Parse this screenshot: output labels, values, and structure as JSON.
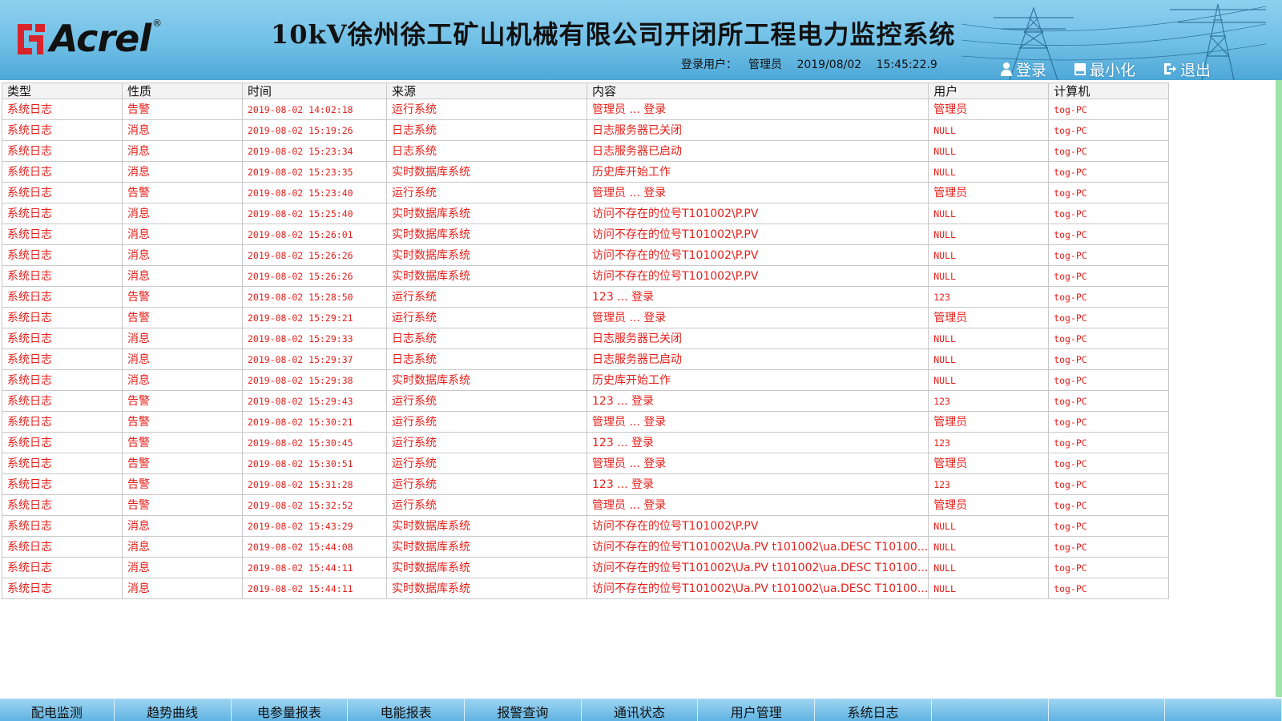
{
  "header": {
    "logo_text": "Acrel",
    "logo_reg": "®",
    "title": "10kV徐州徐工矿山机械有限公司开闭所工程电力监控系统",
    "login_label": "登录用户：",
    "login_user": "管理员",
    "date": "2019/08/02",
    "time": "15:45:22.9",
    "buttons": [
      {
        "label": "登录",
        "icon": "user-icon"
      },
      {
        "label": "最小化",
        "icon": "minimize-icon"
      },
      {
        "label": "退出",
        "icon": "exit-icon"
      }
    ]
  },
  "table": {
    "columns": [
      "类型",
      "性质",
      "时间",
      "来源",
      "内容",
      "用户",
      "计算机"
    ],
    "rows": [
      [
        "系统日志",
        "告警",
        "2019-08-02 14:02:18",
        "运行系统",
        "管理员 ... 登录",
        "管理员",
        "tog-PC"
      ],
      [
        "系统日志",
        "消息",
        "2019-08-02 15:19:26",
        "日志系统",
        "日志服务器已关闭",
        "NULL",
        "tog-PC"
      ],
      [
        "系统日志",
        "消息",
        "2019-08-02 15:23:34",
        "日志系统",
        "日志服务器已启动",
        "NULL",
        "tog-PC"
      ],
      [
        "系统日志",
        "消息",
        "2019-08-02 15:23:35",
        "实时数据库系统",
        "历史库开始工作",
        "NULL",
        "tog-PC"
      ],
      [
        "系统日志",
        "告警",
        "2019-08-02 15:23:40",
        "运行系统",
        "管理员 ... 登录",
        "管理员",
        "tog-PC"
      ],
      [
        "系统日志",
        "消息",
        "2019-08-02 15:25:40",
        "实时数据库系统",
        "访问不存在的位号T101002\\P.PV",
        "NULL",
        "tog-PC"
      ],
      [
        "系统日志",
        "消息",
        "2019-08-02 15:26:01",
        "实时数据库系统",
        "访问不存在的位号T101002\\P.PV",
        "NULL",
        "tog-PC"
      ],
      [
        "系统日志",
        "消息",
        "2019-08-02 15:26:26",
        "实时数据库系统",
        "访问不存在的位号T101002\\P.PV",
        "NULL",
        "tog-PC"
      ],
      [
        "系统日志",
        "消息",
        "2019-08-02 15:26:26",
        "实时数据库系统",
        "访问不存在的位号T101002\\P.PV",
        "NULL",
        "tog-PC"
      ],
      [
        "系统日志",
        "告警",
        "2019-08-02 15:28:50",
        "运行系统",
        "123 ... 登录",
        "123",
        "tog-PC"
      ],
      [
        "系统日志",
        "告警",
        "2019-08-02 15:29:21",
        "运行系统",
        "管理员 ... 登录",
        "管理员",
        "tog-PC"
      ],
      [
        "系统日志",
        "消息",
        "2019-08-02 15:29:33",
        "日志系统",
        "日志服务器已关闭",
        "NULL",
        "tog-PC"
      ],
      [
        "系统日志",
        "消息",
        "2019-08-02 15:29:37",
        "日志系统",
        "日志服务器已启动",
        "NULL",
        "tog-PC"
      ],
      [
        "系统日志",
        "消息",
        "2019-08-02 15:29:38",
        "实时数据库系统",
        "历史库开始工作",
        "NULL",
        "tog-PC"
      ],
      [
        "系统日志",
        "告警",
        "2019-08-02 15:29:43",
        "运行系统",
        "123 ... 登录",
        "123",
        "tog-PC"
      ],
      [
        "系统日志",
        "告警",
        "2019-08-02 15:30:21",
        "运行系统",
        "管理员 ... 登录",
        "管理员",
        "tog-PC"
      ],
      [
        "系统日志",
        "告警",
        "2019-08-02 15:30:45",
        "运行系统",
        "123 ... 登录",
        "123",
        "tog-PC"
      ],
      [
        "系统日志",
        "告警",
        "2019-08-02 15:30:51",
        "运行系统",
        "管理员 ... 登录",
        "管理员",
        "tog-PC"
      ],
      [
        "系统日志",
        "告警",
        "2019-08-02 15:31:28",
        "运行系统",
        "123 ... 登录",
        "123",
        "tog-PC"
      ],
      [
        "系统日志",
        "告警",
        "2019-08-02 15:32:52",
        "运行系统",
        "管理员 ... 登录",
        "管理员",
        "tog-PC"
      ],
      [
        "系统日志",
        "消息",
        "2019-08-02 15:43:29",
        "实时数据库系统",
        "访问不存在的位号T101002\\P.PV",
        "NULL",
        "tog-PC"
      ],
      [
        "系统日志",
        "消息",
        "2019-08-02 15:44:08",
        "实时数据库系统",
        "访问不存在的位号T101002\\Ua.PV t101002\\ua.DESC T10100...",
        "NULL",
        "tog-PC"
      ],
      [
        "系统日志",
        "消息",
        "2019-08-02 15:44:11",
        "实时数据库系统",
        "访问不存在的位号T101002\\Ua.PV t101002\\ua.DESC T10100...",
        "NULL",
        "tog-PC"
      ],
      [
        "系统日志",
        "消息",
        "2019-08-02 15:44:11",
        "实时数据库系统",
        "访问不存在的位号T101002\\Ua.PV t101002\\ua.DESC T10100...",
        "NULL",
        "tog-PC"
      ]
    ]
  },
  "nav": {
    "items": [
      "配电监测",
      "趋势曲线",
      "电参量报表",
      "电能报表",
      "报警查询",
      "通讯状态",
      "用户管理",
      "系统日志",
      "",
      "",
      ""
    ]
  },
  "colors": {
    "row_text": "#e5201b",
    "header_blue": "#6fbfe6",
    "logo_red": "#d8242a"
  }
}
